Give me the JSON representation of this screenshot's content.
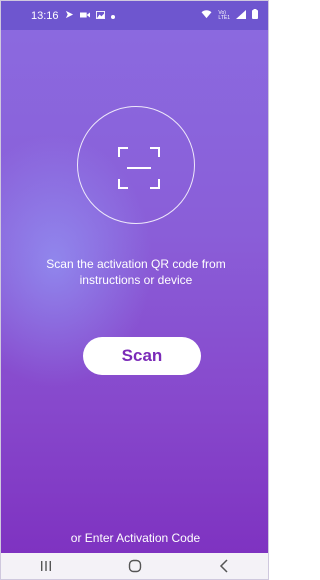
{
  "status_bar": {
    "time": "13:16",
    "left_icons": [
      "send-icon",
      "video-icon",
      "image-icon",
      "dot-icon"
    ],
    "right_icons": [
      "wifi-icon",
      "signal-icon",
      "battery-icon"
    ],
    "network_label": "Vo)\nLTE1"
  },
  "main": {
    "instruction": "Scan the activation QR code from instructions or device",
    "scan_label": "Scan",
    "enter_code_label": "or Enter Activation Code"
  },
  "nav": {
    "icons": [
      "recent-apps-icon",
      "home-icon",
      "back-icon"
    ]
  },
  "colors": {
    "accent": "#7b2bb8",
    "background_top": "#8b6be0",
    "background_bottom": "#7d2fbf"
  }
}
